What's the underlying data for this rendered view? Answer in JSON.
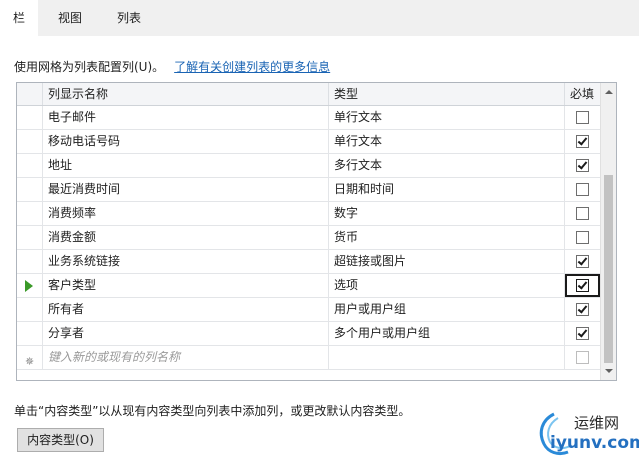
{
  "tabs": [
    {
      "label": "栏",
      "active": true
    },
    {
      "label": "视图",
      "active": false
    },
    {
      "label": "列表",
      "active": false
    }
  ],
  "intro": {
    "text": "使用网格为列表配置列(U)。",
    "link": "了解有关创建列表的更多信息"
  },
  "grid": {
    "headers": {
      "name": "列显示名称",
      "type": "类型",
      "required": "必填"
    },
    "rows": [
      {
        "name": "电子邮件",
        "type": "单行文本",
        "required": false
      },
      {
        "name": "移动电话号码",
        "type": "单行文本",
        "required": true
      },
      {
        "name": "地址",
        "type": "多行文本",
        "required": true
      },
      {
        "name": "最近消费时间",
        "type": "日期和时间",
        "required": false
      },
      {
        "name": "消费频率",
        "type": "数字",
        "required": false
      },
      {
        "name": "消费金额",
        "type": "货币",
        "required": false
      },
      {
        "name": "业务系统链接",
        "type": "超链接或图片",
        "required": true
      },
      {
        "name": "客户类型",
        "type": "选项",
        "required": true,
        "current": true
      },
      {
        "name": "所有者",
        "type": "用户或用户组",
        "required": true
      },
      {
        "name": "分享者",
        "type": "多个用户或用户组",
        "required": true
      }
    ],
    "new_row_placeholder": "键入新的或现有的列名称",
    "scroll_position": 0.35
  },
  "footer": {
    "text": "单击“内容类型”以从现有内容类型向列表中添加列，或更改默认内容类型。",
    "button_label": "内容类型(O)"
  },
  "watermark": {
    "top": "运维网",
    "bottom": "iyunv.com"
  },
  "colors": {
    "accent_link": "#1a64b4",
    "current_row_arrow": "#3a9a28"
  }
}
